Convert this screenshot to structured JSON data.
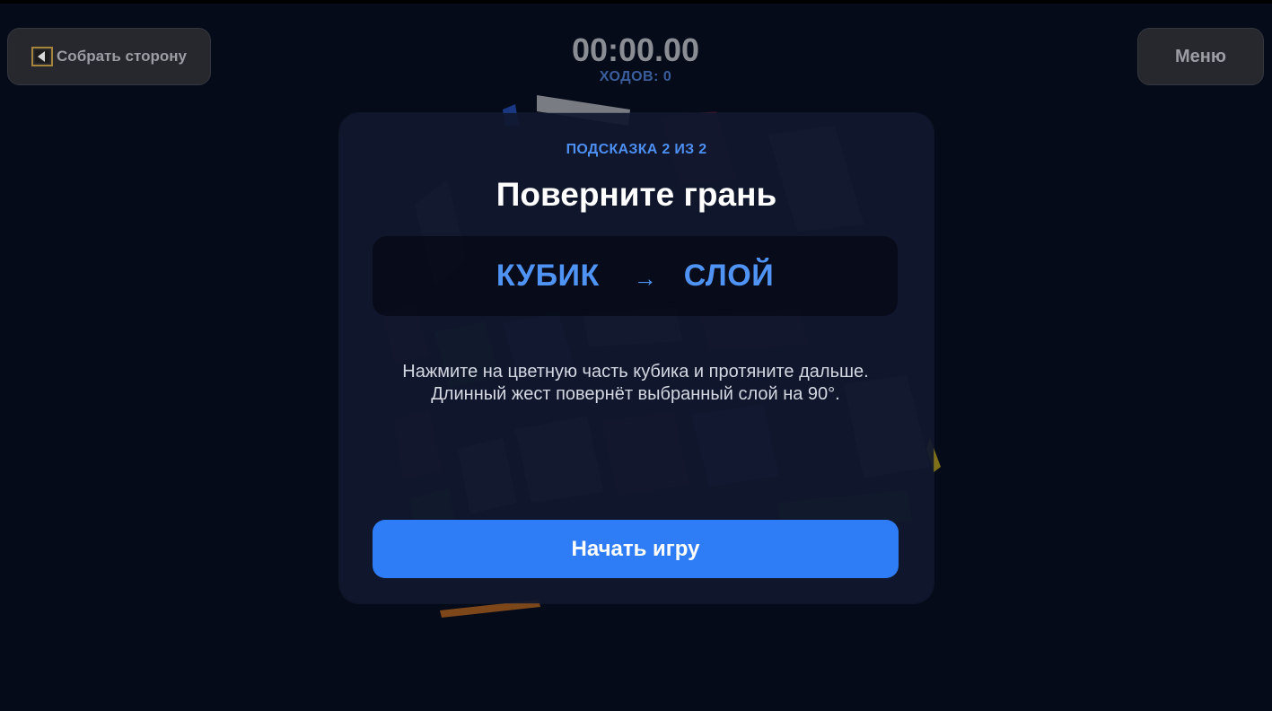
{
  "topbar": {
    "solve_side_label": "Собрать сторону",
    "menu_label": "Меню",
    "timer": "00:00.00",
    "moves": "ХОДОВ: 0"
  },
  "hint": {
    "step": "ПОДСКАЗКА 2 ИЗ 2",
    "title": "Поверните грань",
    "flow_from": "КУБИК",
    "flow_arrow": "→",
    "flow_to": "СЛОЙ",
    "description": "Нажмите на цветную часть кубика и протяните дальше. Длинный жест повернёт выбранный слой на 90°.",
    "start_label": "Начать игру"
  },
  "colors": {
    "background": "#060b1a",
    "accent": "#2f7df6",
    "accent_text": "#4f94f5",
    "card": "#11182e"
  },
  "icons": {
    "solve_side": "play-left-icon"
  }
}
